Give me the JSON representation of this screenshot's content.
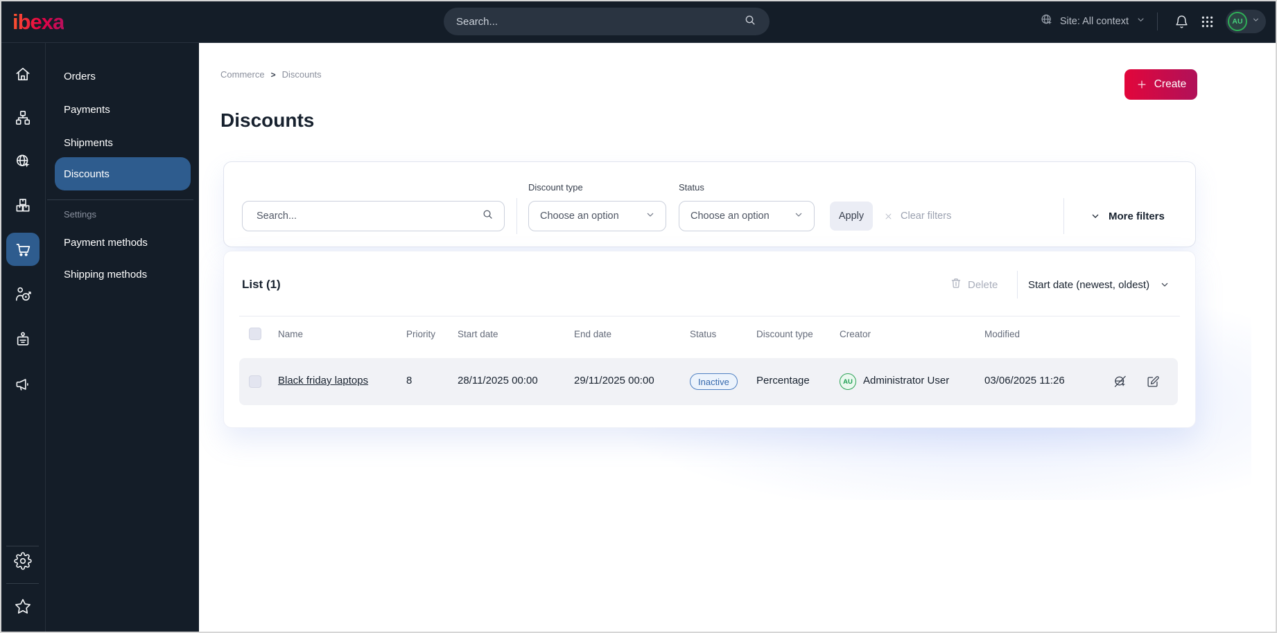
{
  "topbar": {
    "logo_text": "ibexa",
    "search_placeholder": "Search...",
    "site_label": "Site: All context",
    "avatar_initials": "AU",
    "icons": [
      "globe-icon",
      "chevron-down-icon",
      "bell-icon",
      "app-grid-icon"
    ]
  },
  "rail": {
    "icons": [
      "home-icon",
      "content-structure-icon",
      "site-globe-cursor-icon",
      "products-boxes-icon",
      "commerce-cart-icon",
      "customer-target-icon",
      "member-badge-icon",
      "marketing-megaphone-icon",
      "settings-gear-icon",
      "favorites-star-icon"
    ],
    "active": "commerce-cart-icon"
  },
  "menu": {
    "items": [
      {
        "label": "Orders"
      },
      {
        "label": "Payments"
      },
      {
        "label": "Shipments"
      },
      {
        "label": "Discounts"
      }
    ],
    "active_item": "Discounts",
    "section_label": "Settings",
    "section_items": [
      {
        "label": "Payment methods"
      },
      {
        "label": "Shipping methods"
      }
    ]
  },
  "breadcrumb": {
    "items": [
      "Commerce",
      "Discounts"
    ],
    "separator": ">"
  },
  "page": {
    "title": "Discounts",
    "create_label": "Create"
  },
  "filters": {
    "search_placeholder": "Search...",
    "discount_type": {
      "label": "Discount type",
      "value": "Choose an option"
    },
    "status": {
      "label": "Status",
      "value": "Choose an option"
    },
    "apply_label": "Apply",
    "clear_label": "Clear filters",
    "more_label": "More filters"
  },
  "list": {
    "title": "List (1)",
    "delete_label": "Delete",
    "sort_label": "Start date (newest, oldest)",
    "columns": [
      "Name",
      "Priority",
      "Start date",
      "End date",
      "Status",
      "Discount type",
      "Creator",
      "Modified"
    ],
    "rows": [
      {
        "name": "Black friday laptops",
        "priority": "8",
        "start_date": "28/11/2025 00:00",
        "end_date": "29/11/2025 00:00",
        "status": "Inactive",
        "discount_type": "Percentage",
        "creator_initials": "AU",
        "creator": "Administrator User",
        "modified": "03/06/2025 11:26"
      }
    ]
  },
  "colors": {
    "dark_bg": "#141d28",
    "active_blue": "#2e5c8e",
    "brand_red": "#e2063b",
    "brand_magenta": "#b01159",
    "status_inactive_blue": "#3568ac",
    "avatar_green": "#27a155"
  }
}
